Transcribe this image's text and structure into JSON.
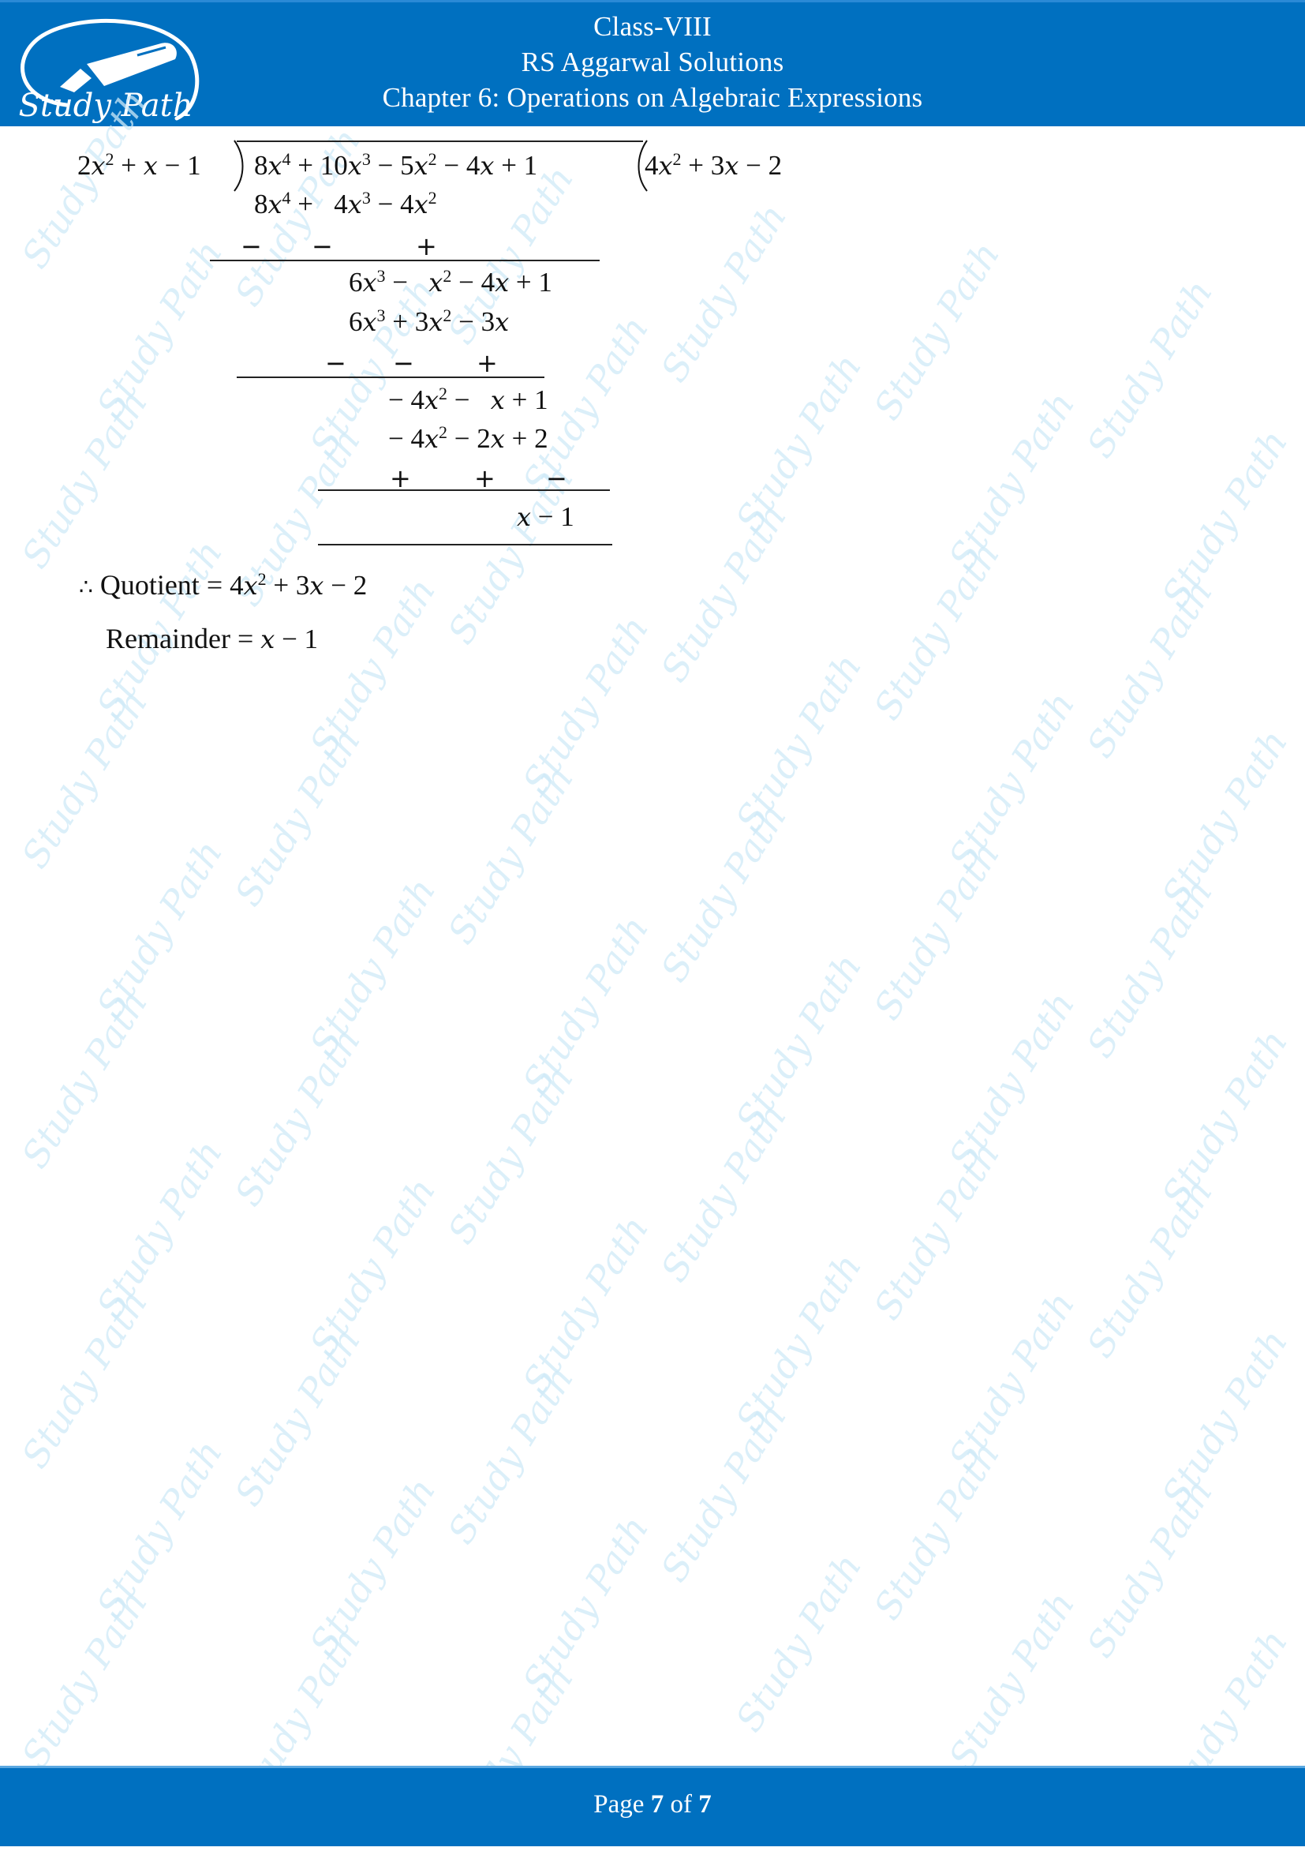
{
  "header": {
    "class_label": "Class-VIII",
    "book_title": "RS Aggarwal Solutions",
    "chapter_title": "Chapter 6: Operations on Algebraic Expressions",
    "logo_text": "Study Path",
    "colors": {
      "band": "#0070c0",
      "text": "#ffffff"
    }
  },
  "division": {
    "divisor": "2x² + x − 1",
    "dividend": "8x⁴ + 10x³ − 5x² − 4x + 1",
    "quotient": "4x² + 3x − 2",
    "steps": [
      {
        "subtract": "8x⁴ + 4x³ − 4x²",
        "signs": [
          "−",
          "−",
          "+"
        ],
        "result": "6x³ − x² − 4x + 1"
      },
      {
        "subtract": "6x³ + 3x² − 3x",
        "signs": [
          "−",
          "−",
          "+"
        ],
        "result": "− 4x² − x + 1"
      },
      {
        "subtract": "− 4x² − 2x + 2",
        "signs": [
          "+",
          "+",
          "−"
        ],
        "result": "x − 1"
      }
    ]
  },
  "conclusion": {
    "therefore_symbol": "∴",
    "quotient_label": "Quotient",
    "quotient_value": "4x² + 3x − 2",
    "remainder_label": "Remainder",
    "remainder_value": "x − 1",
    "equals": "="
  },
  "footer": {
    "page_word": "Page",
    "current_page": "7",
    "of_word": "of",
    "total_pages": "7"
  },
  "watermark": {
    "text": "Study Path",
    "color": "#cfeaf8"
  }
}
